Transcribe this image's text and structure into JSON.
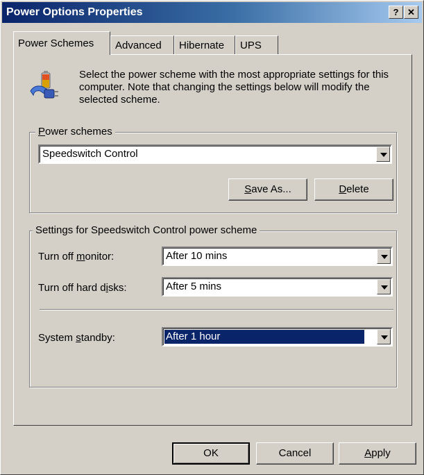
{
  "window": {
    "title": "Power Options Properties",
    "help_btn": "?",
    "close_btn": "✕"
  },
  "tabs": [
    {
      "label": "Power Schemes",
      "active": true
    },
    {
      "label": "Advanced",
      "active": false
    },
    {
      "label": "Hibernate",
      "active": false
    },
    {
      "label": "UPS",
      "active": false
    }
  ],
  "intro": "Select the power scheme with the most appropriate settings for this computer. Note that changing the settings below will modify the selected scheme.",
  "schemes": {
    "label_a": "P",
    "label_b": "ower schemes",
    "selected": "Speedswitch Control",
    "save_as_a": "S",
    "save_as_b": "ave As...",
    "delete_a": "D",
    "delete_b": "elete"
  },
  "settings": {
    "title": "Settings for Speedswitch Control power scheme",
    "monitor_a": "Turn off ",
    "monitor_u": "m",
    "monitor_b": "onitor:",
    "monitor_value": "After 10 mins",
    "disks_a": "Turn off hard d",
    "disks_u": "i",
    "disks_b": "sks:",
    "disks_value": "After 5 mins",
    "standby_a": "System ",
    "standby_u": "s",
    "standby_b": "tandby:",
    "standby_value": "After 1 hour"
  },
  "buttons": {
    "ok": "OK",
    "cancel": "Cancel",
    "apply_u": "A",
    "apply_b": "pply"
  }
}
